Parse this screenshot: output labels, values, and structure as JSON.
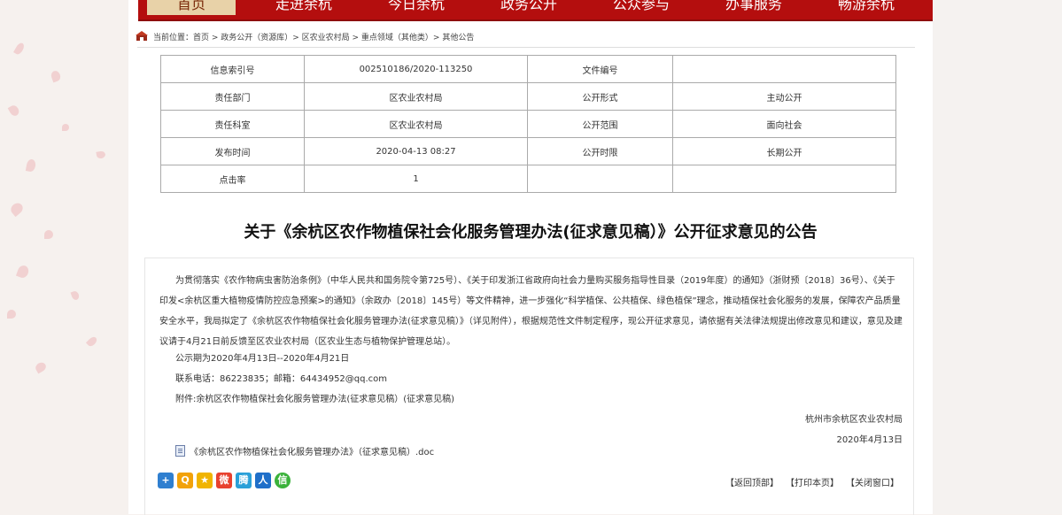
{
  "nav": {
    "items": [
      "首页",
      "走进余杭",
      "今日余杭",
      "政务公开",
      "公众参与",
      "办事服务",
      "畅游余杭"
    ],
    "active_color": "#e8d2a8",
    "bar_color": "#b40e0e"
  },
  "breadcrumb": {
    "text": "当前位置：首页 > 政务公开（资源库）> 区农业农村局 > 重点领域（其他类）> 其他公告"
  },
  "info_table": {
    "rows": [
      {
        "k1": "信息索引号",
        "v1": "002510186/2020-113250",
        "k2": "文件编号",
        "v2": ""
      },
      {
        "k1": "责任部门",
        "v1": "区农业农村局",
        "k2": "公开形式",
        "v2": "主动公开"
      },
      {
        "k1": "责任科室",
        "v1": "区农业农村局",
        "k2": "公开范围",
        "v2": "面向社会"
      },
      {
        "k1": "发布时间",
        "v1": "2020-04-13 08:27",
        "k2": "公开时限",
        "v2": "长期公开"
      },
      {
        "k1": "点击率",
        "v1": "1",
        "k2": "",
        "v2": ""
      }
    ]
  },
  "article": {
    "title": "关于《余杭区农作物植保社会化服务管理办法(征求意见稿）》公开征求意见的公告",
    "paragraph": "为贯彻落实《农作物病虫害防治条例》（中华人民共和国务院令第725号）、《关于印发浙江省政府向社会力量购买服务指导性目录（2019年度）的通知》（浙财预〔2018〕36号）、《关于印发<余杭区重大植物疫情防控应急预案>的通知》（余政办〔2018〕145号）等文件精神，进一步强化“科学植保、公共植保、绿色植保”理念，推动植保社会化服务的发展，保障农产品质量安全水平，我局拟定了《余杭区农作物植保社会化服务管理办法(征求意见稿）》（详见附件），根据规范性文件制定程序，现公开征求意见，请依据有关法律法规提出修改意见和建议，意见及建议请于4月21日前反馈至区农业农村局（区农业生态与植物保护管理总站）。",
    "period": "公示期为2020年4月13日--2020年4月21日",
    "contact": "联系电话：86223835；邮箱：64434952@qq.com",
    "attachment_note": "附件:余杭区农作物植保社会化服务管理办法(征求意见稿）(征求意见稿)",
    "signer": "杭州市余杭区农业农村局",
    "date": "2020年4月13日",
    "attachment_file": "《余杭区农作物植保社会化服务管理办法》（征求意见稿）.doc"
  },
  "share": {
    "icons": [
      {
        "name": "share-more-icon",
        "glyph": "+",
        "color": "#2f7fd0"
      },
      {
        "name": "qq-icon",
        "glyph": "Q",
        "color": "#f2a20a"
      },
      {
        "name": "qzone-icon",
        "glyph": "★",
        "color": "#f0b400"
      },
      {
        "name": "weibo-icon",
        "glyph": "微",
        "color": "#e8412e"
      },
      {
        "name": "tencent-weibo-icon",
        "glyph": "腾",
        "color": "#2aa0d8"
      },
      {
        "name": "renren-icon",
        "glyph": "人",
        "color": "#1f6fc9"
      },
      {
        "name": "wechat-icon",
        "glyph": "信",
        "color": "#3bb23b"
      }
    ]
  },
  "actions": {
    "back_top": "【返回顶部】",
    "print": "【打印本页】",
    "close": "【关闭窗口】"
  }
}
